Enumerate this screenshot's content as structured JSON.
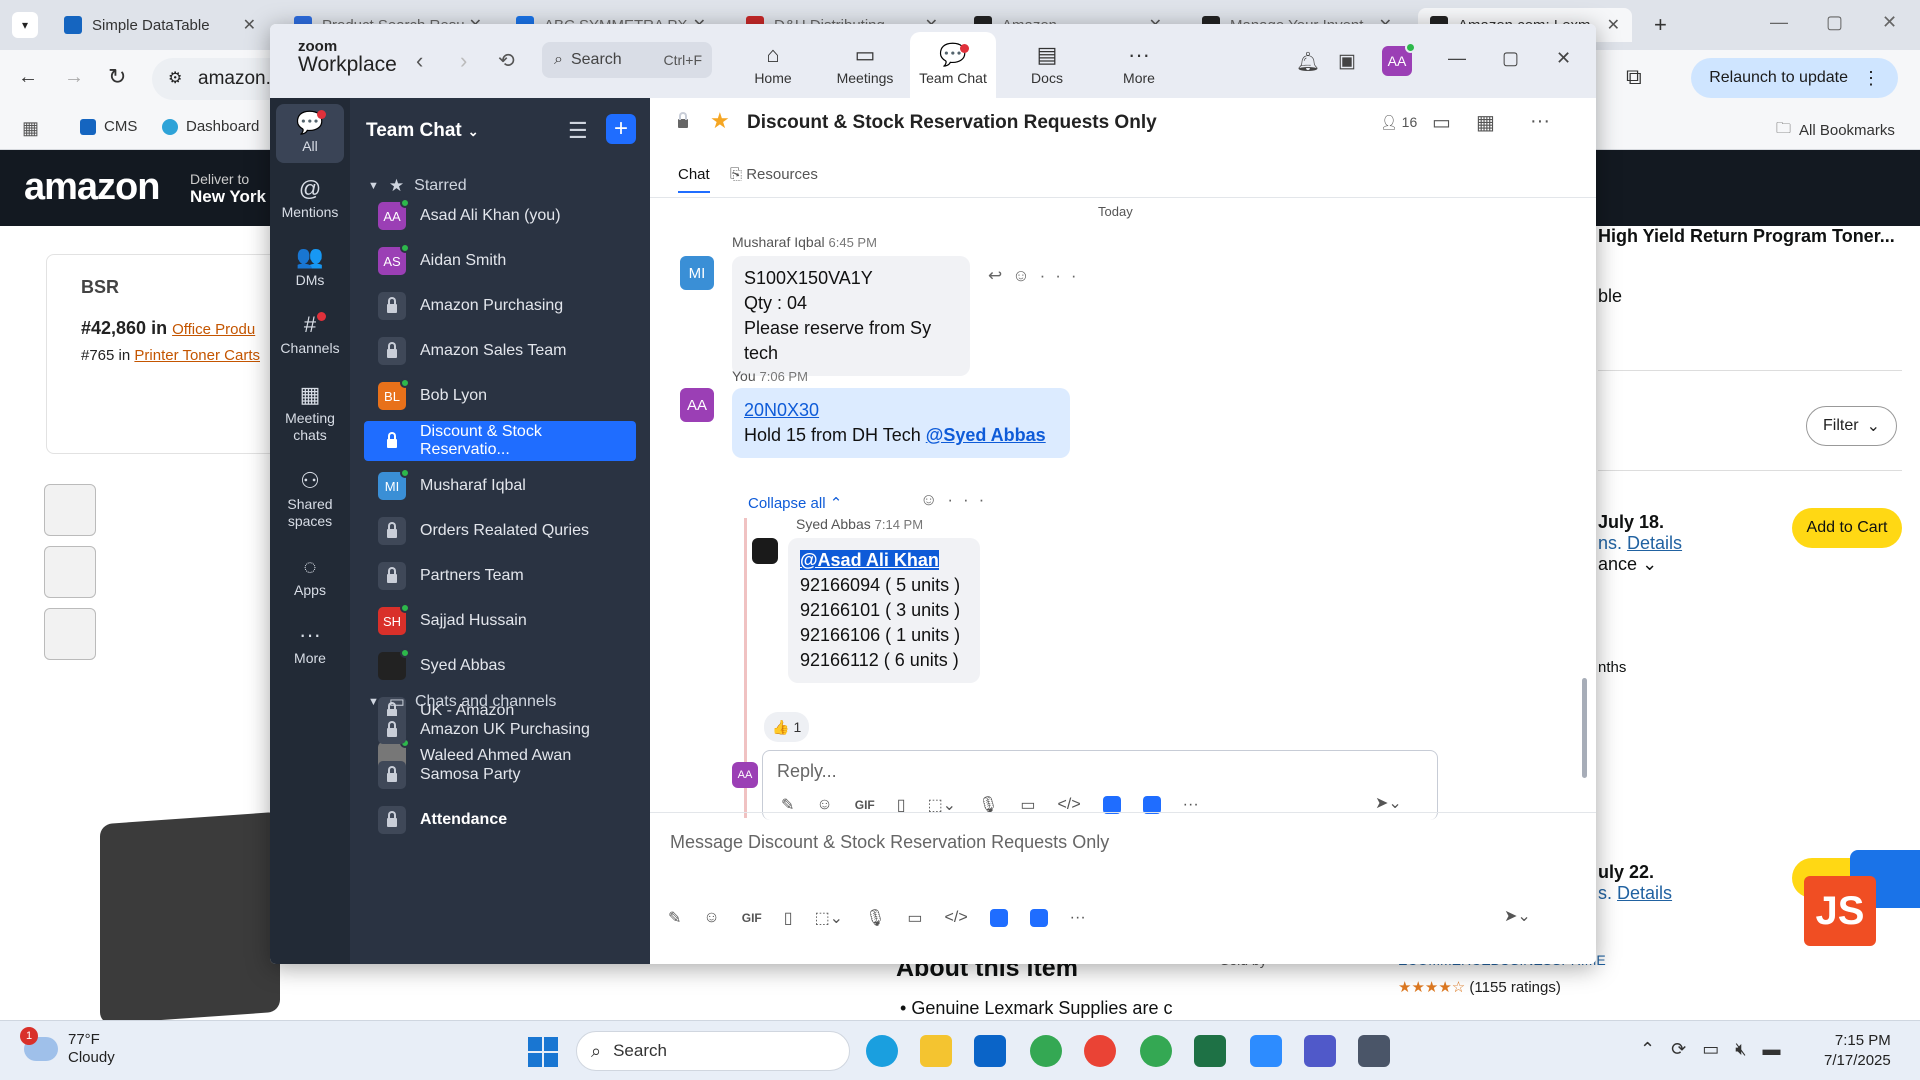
{
  "browser": {
    "tabs": [
      {
        "label": "Simple DataTable",
        "color": "#1565c0"
      },
      {
        "label": "Product Search Resu",
        "color": "#2d6cdf"
      },
      {
        "label": "ABC SYMMETRA PX",
        "color": "#1a73e8"
      },
      {
        "label": "D&H Distributing",
        "color": "#c62828"
      },
      {
        "label": "Amazon",
        "color": "#222222"
      },
      {
        "label": "Manage Your Invent",
        "color": "#222222"
      },
      {
        "label": "Amazon.com: Lexm",
        "color": "#222222"
      }
    ],
    "address": "amazon.c",
    "bookmarks": {
      "cms": "CMS",
      "dashboard": "Dashboard",
      "all": "All Bookmarks"
    },
    "relaunch": "Relaunch to update",
    "profile_initial": "A"
  },
  "amazon": {
    "deliver_line1": "Deliver to",
    "deliver_line2": "New York",
    "bsr_heading": "BSR",
    "bsr_rank1": "#42,860 in",
    "bsr_cat1": "Office Produ",
    "bsr_rank2": "#765 in",
    "bsr_cat2": "Printer Toner Carts",
    "title": "High Yield Return Program Toner...",
    "title_sub": "ble",
    "filter": "Filter",
    "card1_date": "July 18.",
    "card1_frag": "ns.",
    "card1_details": "Details",
    "card1_more": "ance",
    "card1_months": "nths",
    "add_to_cart": "Add to Cart",
    "card2_date": "uly 22.",
    "card2_frag": "s.",
    "card2_details": "Details",
    "about": "About this item",
    "about_item": "Genuine Lexmark Supplies are c",
    "sold_by": "Sold by",
    "seller": "ECOMMERCEBUSINESSPRIME",
    "stars": "★★★★☆",
    "ratings": "(1155 ratings)",
    "js_badge": "JS"
  },
  "zoom": {
    "logo_line1": "zoom",
    "logo_line2": "Workplace",
    "search_label": "Search",
    "search_shortcut": "Ctrl+F",
    "nav": [
      {
        "label": "Home",
        "icon": "⌂"
      },
      {
        "label": "Meetings",
        "icon": "▭"
      },
      {
        "label": "Team Chat",
        "icon": "💬"
      },
      {
        "label": "Docs",
        "icon": "▤"
      },
      {
        "label": "More",
        "icon": "···"
      }
    ],
    "user_initials": "AA",
    "rail": [
      {
        "label": "All",
        "icon": "💬"
      },
      {
        "label": "Mentions",
        "icon": "@"
      },
      {
        "label": "DMs",
        "icon": "👥"
      },
      {
        "label": "Channels",
        "icon": "#"
      },
      {
        "label": "Meeting chats",
        "icon": "▦"
      },
      {
        "label": "Shared spaces",
        "icon": "⚇"
      },
      {
        "label": "Apps",
        "icon": "◌"
      },
      {
        "label": "More",
        "icon": "···"
      }
    ],
    "sidebar": {
      "title": "Team Chat",
      "starred": "Starred",
      "chats_and_channels": "Chats and channels",
      "starred_items": [
        {
          "label": "Asad Ali Khan (you)",
          "initials": "AA",
          "color": "#9b3fb5",
          "type": "user"
        },
        {
          "label": "Aidan Smith",
          "initials": "AS",
          "color": "#9b3fb5",
          "type": "user"
        },
        {
          "label": "Amazon Purchasing",
          "type": "channel"
        },
        {
          "label": "Amazon Sales Team",
          "type": "channel"
        },
        {
          "label": "Bob Lyon",
          "initials": "BL",
          "color": "#e8711a",
          "type": "user"
        },
        {
          "label": "Discount & Stock Reservatio...",
          "type": "channel",
          "active": true
        },
        {
          "label": "Musharaf Iqbal",
          "initials": "MI",
          "color": "#3a8fd6",
          "type": "user"
        },
        {
          "label": "Orders Realated Quries",
          "type": "channel"
        },
        {
          "label": "Partners Team",
          "type": "channel"
        },
        {
          "label": "Sajjad Hussain",
          "initials": "SH",
          "color": "#d9302a",
          "type": "user"
        },
        {
          "label": "Syed Abbas",
          "initials": "",
          "color": "#222222",
          "type": "user"
        },
        {
          "label": "UK - Amazon",
          "type": "channel"
        },
        {
          "label": "Waleed Ahmed Awan",
          "initials": "",
          "color": "#777777",
          "type": "user"
        }
      ],
      "channel_items": [
        {
          "label": "Amazon UK Purchasing",
          "type": "channel"
        },
        {
          "label": "Samosa Party",
          "type": "channel"
        },
        {
          "label": "Attendance",
          "type": "channel",
          "bold": true
        }
      ]
    },
    "channel": {
      "title": "Discount & Stock Reservation Requests Only",
      "members": "16",
      "tabs": {
        "chat": "Chat",
        "resources": "Resources"
      },
      "today": "Today"
    },
    "messages": {
      "m1": {
        "sender": "Musharaf Iqbal",
        "time": "6:45 PM",
        "initials": "MI",
        "lines": [
          "S100X150VA1Y",
          "Qty  : 04",
          "Please reserve from Sy tech"
        ]
      },
      "m2": {
        "sender": "You",
        "time": "7:06 PM",
        "initials": "AA",
        "link": "20N0X30",
        "text": "Hold 15 from DH Tech",
        "mention": "@Syed Abbas"
      },
      "collapse": "Collapse all",
      "reply": {
        "sender": "Syed Abbas",
        "time": "7:14 PM",
        "mention": "@Asad Ali Khan",
        "lines": [
          "92166094 ( 5 units )",
          "92166101 ( 3 units )",
          "92166106 ( 1 units )",
          "92166112 ( 6 units )"
        ],
        "reaction": "👍",
        "reaction_count": "1"
      },
      "reply_placeholder": "Reply...",
      "composer_placeholder": "Message Discount & Stock Reservation Requests Only"
    },
    "toolbar_gif": "GIF"
  },
  "taskbar": {
    "weather_temp": "77°F",
    "weather_desc": "Cloudy",
    "weather_badge": "1",
    "search": "Search",
    "time": "7:15 PM",
    "date": "7/17/2025"
  }
}
